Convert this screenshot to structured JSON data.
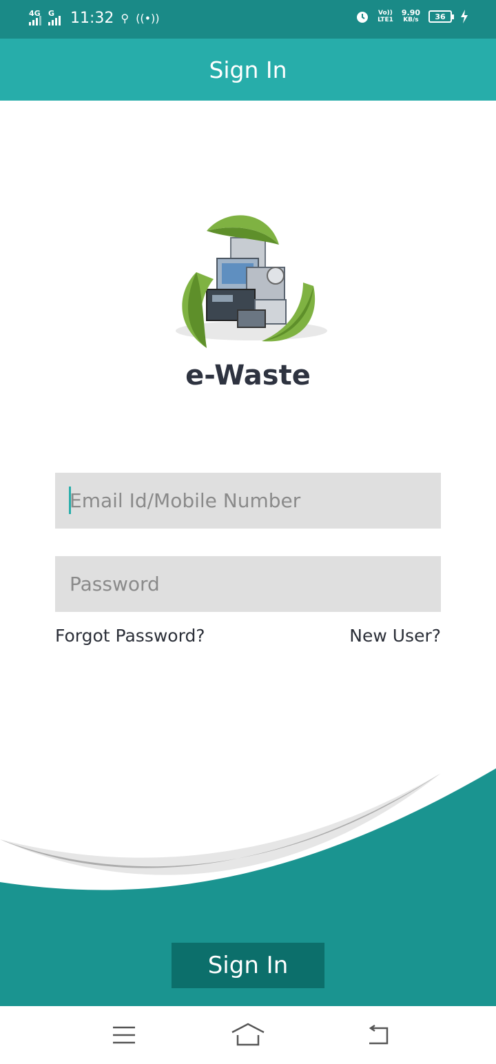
{
  "status_bar": {
    "network1": "4G",
    "network2": "G",
    "time": "11:32",
    "volte_top": "Vo))",
    "volte_bottom": "LTE1",
    "speed_value": "9.90",
    "speed_unit": "KB/s",
    "battery": "36"
  },
  "header": {
    "title": "Sign In"
  },
  "logo": {
    "brand_name": "e-Waste"
  },
  "form": {
    "email_placeholder": "Email Id/Mobile Number",
    "password_placeholder": "Password",
    "forgot_label": "Forgot Password?",
    "new_user_label": "New User?"
  },
  "footer": {
    "sign_in_label": "Sign In"
  },
  "colors": {
    "teal_dark": "#1a8a87",
    "teal": "#27adaa",
    "teal_wave": "#1a9490",
    "button": "#0c6f6b",
    "field_bg": "#dfdfdf"
  },
  "nav_icons": [
    "menu-icon",
    "home-icon",
    "back-icon"
  ]
}
